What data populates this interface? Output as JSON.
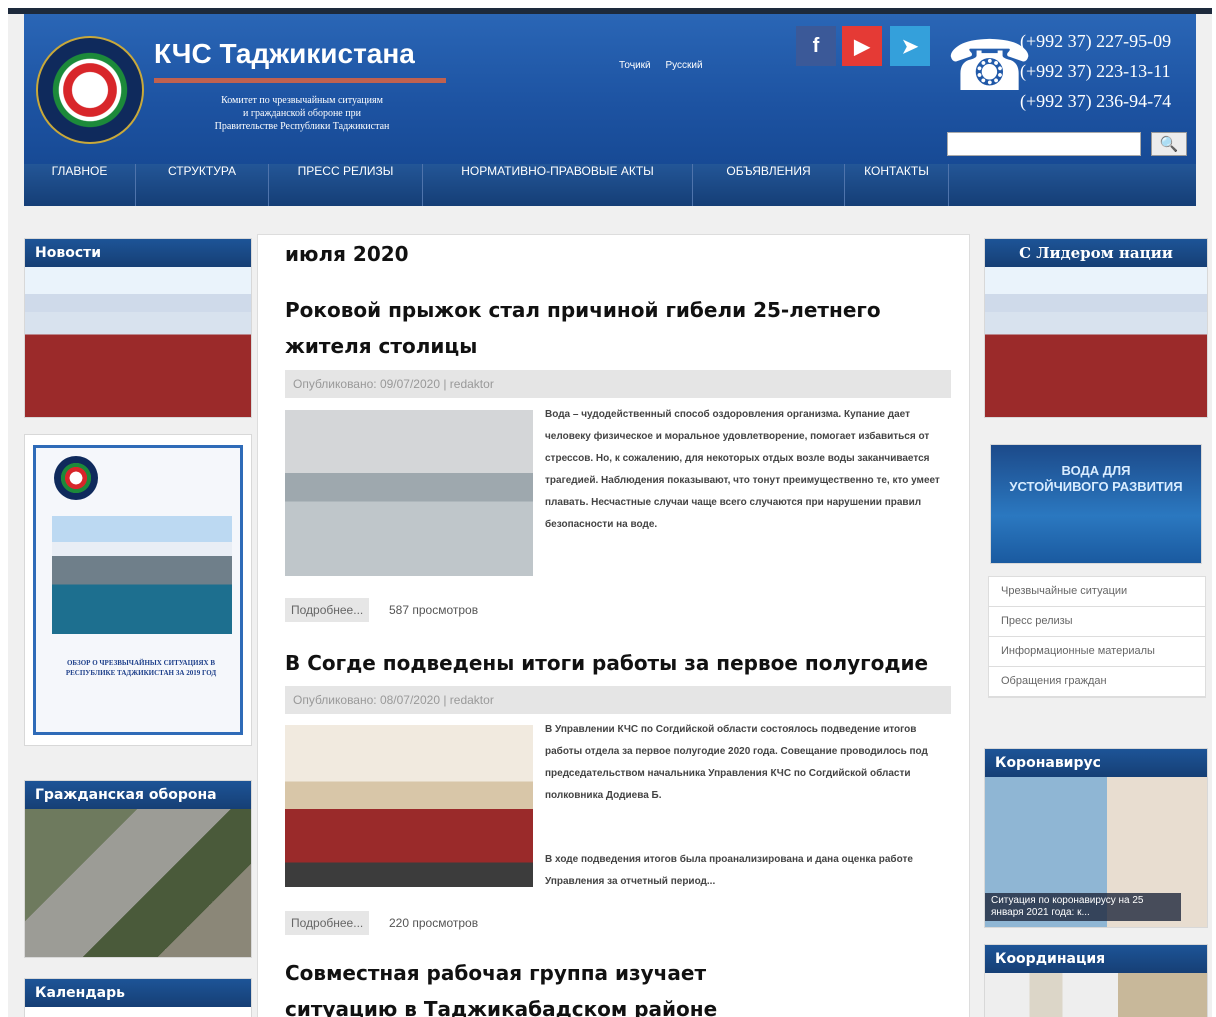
{
  "header": {
    "title": "КЧС Таджикистана",
    "subtitle_line1": "Комитет по чрезвычайным ситуациям",
    "subtitle_line2": "и гражданской обороне при",
    "subtitle_line3": "Правительстве Республики Таджикистан",
    "lang_tj": "Тоҷикӣ",
    "lang_ru": "Русский",
    "social_fb": "f",
    "social_yt": "▶",
    "social_tg": "➤",
    "phones": [
      "(+992 37) 227-95-09",
      "(+992 37) 223-13-11",
      "(+992 37) 236-94-74"
    ],
    "search_icon": "magnifier-icon",
    "search_glyph": "🔍"
  },
  "nav": [
    "ГЛАВНОЕ",
    "СТРУКТУРА",
    "ПРЕСС РЕЛИЗЫ",
    "НОРМАТИВНО-ПРАВОВЫЕ АКТЫ",
    "ОБЪЯВЛЕНИЯ",
    "КОНТАКТЫ"
  ],
  "main": {
    "heading": "июля 2020",
    "posts": [
      {
        "title": "Роковой прыжок стал причиной гибели 25-летнего жителя столицы",
        "meta": "Опубликовано: 09/07/2020 | redaktor",
        "excerpt": "Вода – чудодейственный способ оздоровления организма. Купание дает человеку физическое и моральное удовлетворение, помогает избавиться от стрессов. Но, к сожалению, для некоторых отдых возле воды заканчивается трагедией. Наблюдения показывают, что тонут преимущественно те, кто умеет плавать. Несчастные случаи чаще всего случаются при нарушении правил безопасности на воде.",
        "readmore": "Подробнее...",
        "views": "587 просмотров"
      },
      {
        "title": "В Согде подведены итоги работы за первое полугодие",
        "meta": "Опубликовано: 08/07/2020 | redaktor",
        "excerpt_p1": "В Управлении КЧС по Согдийской области состоялось подведение итогов работы отдела за первое полугодие 2020 года. Совещание проводилось под председательством начальника Управления КЧС по Согдийской области полковника Додиева Б.",
        "excerpt_p2": "В ходе подведения итогов была проанализирована и дана оценка работе Управления за отчетный период...",
        "readmore": "Подробнее...",
        "views": "220 просмотров"
      },
      {
        "title": "Совместная рабочая группа изучает ситуацию в Таджикабадском районе"
      }
    ]
  },
  "left": {
    "news": "Новости",
    "civil": "Гражданская оборона",
    "calendar": "Календарь",
    "report_title": "ОБЗОР О ЧРЕЗВЫЧАЙНЫХ СИТУАЦИЯХ В РЕСПУБЛИКЕ ТАДЖИКИСТАН ЗА 2019 ГОД"
  },
  "right": {
    "leader": "С Лидером нации",
    "water_line1": "ВОДА ДЛЯ",
    "water_line2": "УСТОЙЧИВОГО РАЗВИТИЯ",
    "links": [
      "Чрезвычайные ситуации",
      "Пресс релизы",
      "Информационные материалы",
      "Обращения граждан"
    ],
    "covid": "Коронавирус",
    "covid_caption": "Ситуация по коронавирусу на 25 января 2021 года: к...",
    "coord": "Координация"
  }
}
